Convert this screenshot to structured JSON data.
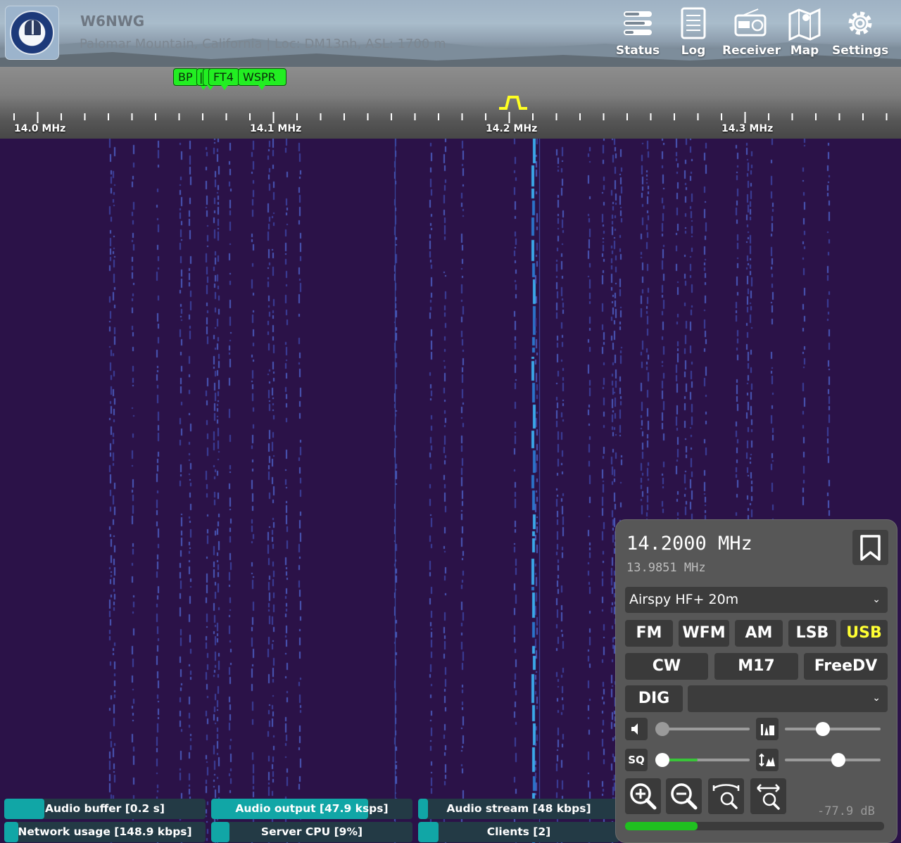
{
  "header": {
    "callsign": "W6NWG",
    "location": "Palomar Mountain, California | Loc: DM13nh, ASL: 1700 m",
    "nav": [
      {
        "label": "Status",
        "icon": "status-icon"
      },
      {
        "label": "Log",
        "icon": "log-icon"
      },
      {
        "label": "Receiver",
        "icon": "radio-icon"
      },
      {
        "label": "Map",
        "icon": "map-icon"
      },
      {
        "label": "Settings",
        "icon": "gear-icon"
      }
    ]
  },
  "bookmarks": [
    {
      "label": "BP"
    },
    {
      "label": "|"
    },
    {
      "label": "FT4"
    },
    {
      "label": "WSPR"
    }
  ],
  "scale": {
    "labels": [
      "14.0 MHz",
      "14.1 MHz",
      "14.2 MHz",
      "14.3 MHz"
    ]
  },
  "status_bars": [
    {
      "label": "Audio buffer [0.2 s]",
      "level": 0.2
    },
    {
      "label": "Audio output [47.9 ksps]",
      "level": 0.78
    },
    {
      "label": "Audio stream [48 kbps]",
      "level": 0.05
    },
    {
      "label": "Network usage [148.9 kbps]",
      "level": 0.07
    },
    {
      "label": "Server CPU [9%]",
      "level": 0.09
    },
    {
      "label": "Clients [2]",
      "level": 0.1
    }
  ],
  "receiver": {
    "frequency": "14.2000 MHz",
    "offset_frequency": "13.9851 MHz",
    "profile": "Airspy HF+ 20m",
    "modes_row1": [
      "FM",
      "WFM",
      "AM",
      "LSB",
      "USB"
    ],
    "modes_row2": [
      "CW",
      "M17",
      "FreeDV"
    ],
    "dig_label": "DIG",
    "dig_select_value": "",
    "active_mode": "USB",
    "squelch_label": "SQ",
    "volume_level": 0.0,
    "squelch_level": 0.0,
    "squelch_signal_level": 0.45,
    "nr_level": 0.38,
    "agc_level": 0.57,
    "db_readout": "-77.9 dB",
    "smeter_level": 0.28
  },
  "colors": {
    "waterfall_bg": "#2b1248",
    "bookmark": "#22ee22",
    "active_mode": "#ffff33",
    "status_fill": "#11a6a6"
  }
}
